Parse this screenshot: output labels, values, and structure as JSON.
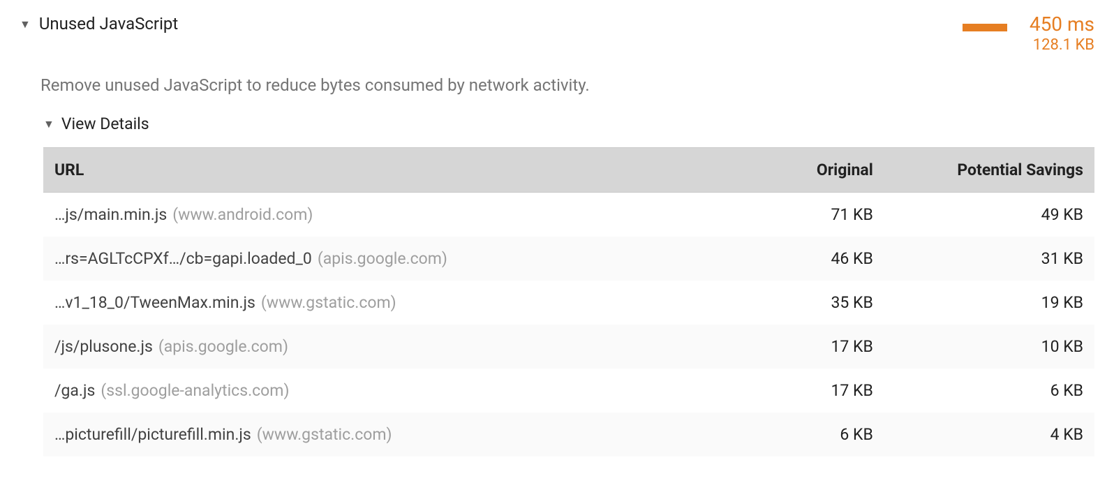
{
  "audit": {
    "title": "Unused JavaScript",
    "description": "Remove unused JavaScript to reduce bytes consumed by network activity.",
    "metric_time": "450 ms",
    "metric_size": "128.1 KB",
    "view_details_label": "View Details"
  },
  "table": {
    "headers": {
      "url": "URL",
      "original": "Original",
      "savings": "Potential Savings"
    },
    "rows": [
      {
        "path": "…js/main.min.js",
        "host": "(www.android.com)",
        "original": "71 KB",
        "savings": "49 KB"
      },
      {
        "path": "…rs=AGLTcCPXf…/cb=gapi.loaded_0",
        "host": "(apis.google.com)",
        "original": "46 KB",
        "savings": "31 KB"
      },
      {
        "path": "…v1_18_0/TweenMax.min.js",
        "host": "(www.gstatic.com)",
        "original": "35 KB",
        "savings": "19 KB"
      },
      {
        "path": "/js/plusone.js",
        "host": "(apis.google.com)",
        "original": "17 KB",
        "savings": "10 KB"
      },
      {
        "path": "/ga.js",
        "host": "(ssl.google-analytics.com)",
        "original": "17 KB",
        "savings": "6 KB"
      },
      {
        "path": "…picturefill/picturefill.min.js",
        "host": "(www.gstatic.com)",
        "original": "6 KB",
        "savings": "4 KB"
      }
    ]
  }
}
